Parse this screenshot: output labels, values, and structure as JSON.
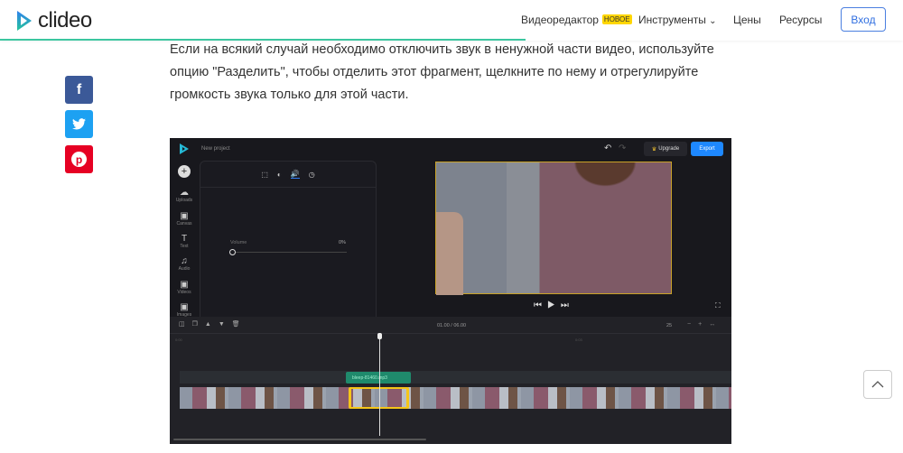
{
  "header": {
    "logo": "clideo",
    "nav": [
      {
        "label": "Видеоредактор",
        "badge": "НОВОЕ"
      },
      {
        "label": "Инструменты"
      },
      {
        "label": "Цены"
      },
      {
        "label": "Ресурсы"
      }
    ],
    "login": "Вход"
  },
  "article": {
    "paragraph": "Если на всякий случай необходимо отключить звук в ненужной части видео, используйте опцию \"Разделить\", чтобы отделить этот фрагмент, щелкните по нему и отрегулируйте громкость звука только для этой части."
  },
  "social": [
    {
      "icon": "f",
      "color": "#3b5998"
    },
    {
      "icon": "t",
      "color": "#1da1f2"
    },
    {
      "icon": "p",
      "color": "#e60023"
    }
  ],
  "editor": {
    "project": "New project",
    "upgrade": "Upgrade",
    "export": "Export",
    "sidebar": [
      "Uploads",
      "Canvas",
      "Text",
      "Audio",
      "Videos",
      "Images"
    ],
    "volume_label": "Volume",
    "volume_value": "0%",
    "volume_fraction": 0,
    "time": "01.00 / 06.00",
    "ruler": [
      "0:00",
      "0:03"
    ],
    "zoom": "25",
    "audio_clip": "bleep-81460.mp3"
  }
}
